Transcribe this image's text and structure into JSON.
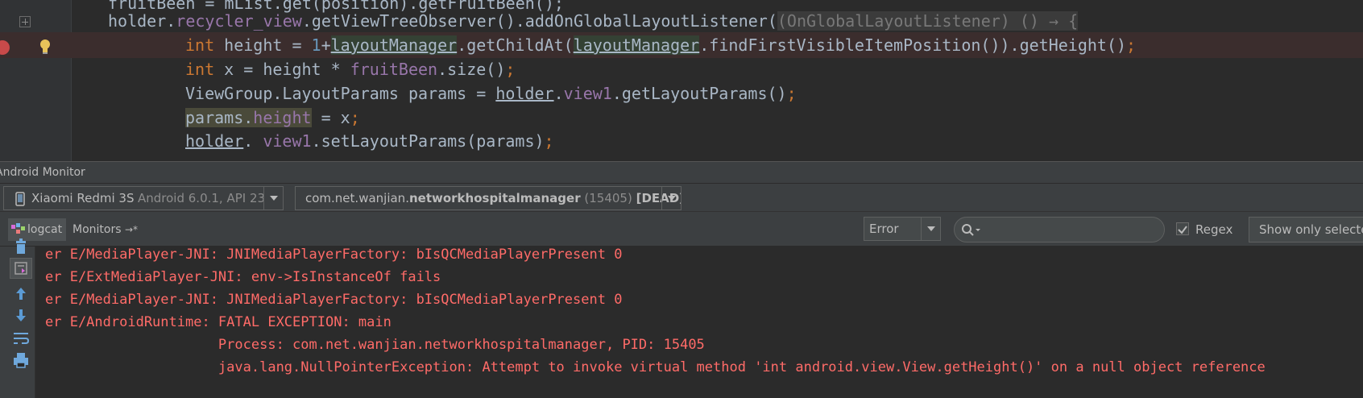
{
  "editor": {
    "lines": [
      {
        "parts": [
          [
            "plain",
            "fruitBeen = mList.get(position).getFruitBeen();"
          ]
        ]
      },
      {
        "parts": [
          [
            "plain",
            "holder."
          ],
          [
            "field",
            "recycler_view"
          ],
          [
            "plain",
            ".getViewTreeObserver().addOnGlobalLayoutListener("
          ],
          [
            "hint",
            "(OnGlobalLayoutListener) () → {"
          ]
        ]
      },
      {
        "parts": [
          [
            "kw",
            "int "
          ],
          [
            "plain",
            "height = "
          ],
          [
            "num",
            "1"
          ],
          [
            "plain",
            "+"
          ],
          [
            "ulhl",
            "layoutManager"
          ],
          [
            "plain",
            ".getChildAt("
          ],
          [
            "ulhl",
            "layoutManager"
          ],
          [
            "plain",
            ".findFirstVisibleItemPosition()).getHeight()"
          ],
          [
            "kw",
            ";"
          ]
        ]
      },
      {
        "parts": [
          [
            "kw",
            "int "
          ],
          [
            "plain",
            "x = height * "
          ],
          [
            "field",
            "fruitBeen"
          ],
          [
            "plain",
            ".size()"
          ],
          [
            "kw",
            ";"
          ]
        ]
      },
      {
        "parts": [
          [
            "plain",
            "ViewGroup.LayoutParams params = "
          ],
          [
            "ul",
            "holder"
          ],
          [
            "plain",
            "."
          ],
          [
            "field",
            "view1"
          ],
          [
            "plain",
            ".getLayoutParams()"
          ],
          [
            "kw",
            ";"
          ]
        ]
      },
      {
        "parts": [
          [
            "hl2",
            "params."
          ],
          [
            "hl2field",
            "height"
          ],
          [
            "plain",
            " = x"
          ],
          [
            "kw",
            ";"
          ]
        ]
      },
      {
        "parts": [
          [
            "ul",
            "holder"
          ],
          [
            "plain",
            ". "
          ],
          [
            "field",
            "view1"
          ],
          [
            "plain",
            ".setLayoutParams(params)"
          ],
          [
            "kw",
            ";"
          ]
        ]
      }
    ]
  },
  "monitor": {
    "title": "Android Monitor",
    "device": {
      "name": "Xiaomi Redmi 3S",
      "os": "Android 6.0.1, API 23"
    },
    "process": {
      "prefix": "com.net.wanjian.",
      "name": "networkhospitalmanager",
      "pid": "(15405)",
      "state": "[DEAD]"
    },
    "tabs": {
      "logcat": "logcat",
      "monitors": "Monitors"
    },
    "level": "Error",
    "search_placeholder": "",
    "regex_label": "Regex",
    "regex_checked": true,
    "filter_label": "Show only selected application"
  },
  "log": [
    "er E/MediaPlayer-JNI: JNIMediaPlayerFactory: bIsQCMediaPlayerPresent 0",
    "er E/ExtMediaPlayer-JNI: env->IsInstanceOf fails",
    "er E/MediaPlayer-JNI: JNIMediaPlayerFactory: bIsQCMediaPlayerPresent 0",
    "er E/AndroidRuntime: FATAL EXCEPTION: main",
    "                     Process: com.net.wanjian.networkhospitalmanager, PID: 15405",
    "                     java.lang.NullPointerException: Attempt to invoke virtual method 'int android.view.View.getHeight()' on a null object reference"
  ],
  "colors": {
    "log_error": "#ff6b68",
    "keyword": "#cc7832",
    "field": "#9876aa",
    "number": "#6897bb"
  }
}
